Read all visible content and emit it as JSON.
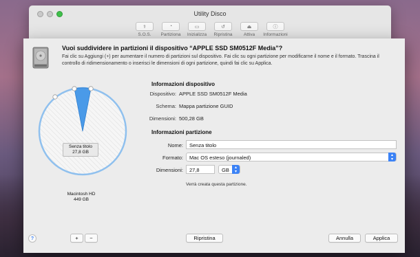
{
  "window": {
    "title": "Utility Disco",
    "toolbar": [
      {
        "label": "S.O.S.",
        "icon": "stethoscope-icon",
        "glyph": "⚕"
      },
      {
        "label": "Partiziona",
        "icon": "partition-icon",
        "glyph": "◔"
      },
      {
        "label": "Inizializza",
        "icon": "erase-icon",
        "glyph": "▭"
      },
      {
        "label": "Ripristina",
        "icon": "restore-icon",
        "glyph": "↺"
      },
      {
        "label": "Attiva",
        "icon": "mount-icon",
        "glyph": "⏏"
      },
      {
        "label": "Informazioni",
        "icon": "info-icon",
        "glyph": "ⓘ"
      }
    ]
  },
  "sheet": {
    "title": "Vuoi suddividere in partizioni il dispositivo “APPLE SSD SM0512F Media”?",
    "description": "Fai clic su Aggiungi (+) per aumentare il numero di partizioni sul dispositivo. Fai clic su ogni partizione per modificarne il nome e il formato. Trascina il controllo di ridimensionamento o inserisci le dimensioni di ogni partizione, quindi fai clic su Applica."
  },
  "pie": {
    "partitions": [
      {
        "name": "Senza titolo",
        "size": "27,8 GB",
        "gb": 27.8,
        "selected": true
      },
      {
        "name": "Macintosh HD",
        "size": "449 GB",
        "gb": 449,
        "selected": false
      }
    ],
    "selected_color": "#4a9ae8",
    "border_color": "#8fc0ee"
  },
  "device_info": {
    "heading": "Informazioni dispositivo",
    "rows": [
      {
        "key": "Dispositivo:",
        "value": "APPLE SSD SM0512F Media"
      },
      {
        "key": "Schema:",
        "value": "Mappa partizione GUID"
      },
      {
        "key": "Dimensioni:",
        "value": "500,28 GB"
      }
    ]
  },
  "partition_info": {
    "heading": "Informazioni partizione",
    "name_label": "Nome:",
    "name_value": "Senza titolo",
    "format_label": "Formato:",
    "format_value": "Mac OS esteso (journaled)",
    "size_label": "Dimensioni:",
    "size_value": "27,8",
    "unit_value": "GB",
    "note": "Verrà creata questa partizione."
  },
  "buttons": {
    "help": "?",
    "add": "+",
    "remove": "−",
    "revert": "Ripristina",
    "cancel": "Annulla",
    "apply": "Applica"
  },
  "colors": {
    "accent": "#3b82f6",
    "maximize": "#3fc04a"
  }
}
